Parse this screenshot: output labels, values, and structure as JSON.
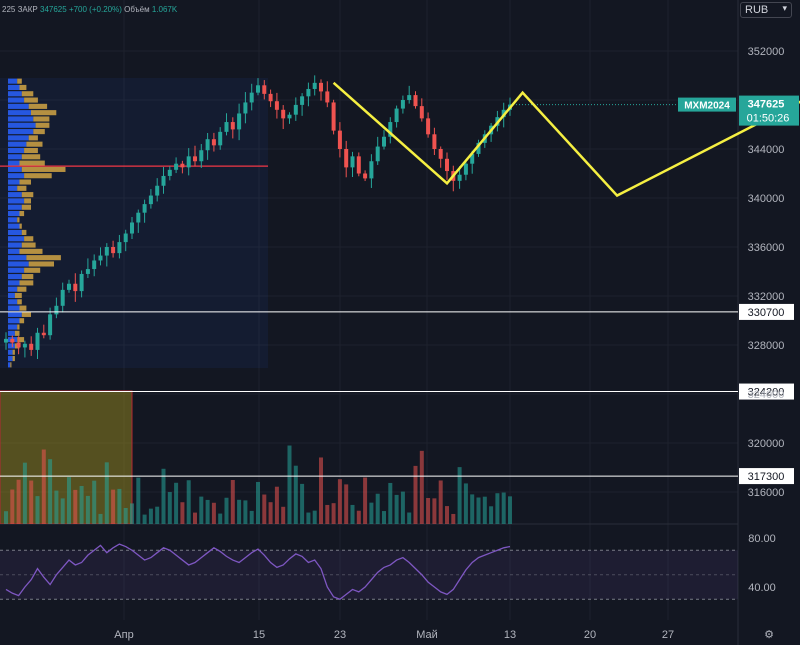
{
  "legend": {
    "prefix": "225",
    "close_label": "ЗАКР",
    "close_value": "347625",
    "change": "+700 (+0.20%)",
    "volume_label": "Объём",
    "volume_value": "1.067K"
  },
  "currency": "RUB",
  "symbol": "MXM2024",
  "last_price": "347625",
  "countdown": "01:50:26",
  "colors": {
    "background": "#131722",
    "up": "#26a69a",
    "down": "#ef5350",
    "annotation": "#f5ef42",
    "rsi": "#7e57c2",
    "poc": "#f23645",
    "level": "#ffffff",
    "vp_up": "#2962ff",
    "vp_down": "#d1a544"
  },
  "chart_data": {
    "type": "candlestick",
    "y_axis": {
      "range": [
        313000,
        355000
      ],
      "ticks": [
        316000,
        320000,
        324000,
        328000,
        332000,
        336000,
        340000,
        344000,
        348000,
        352000
      ]
    },
    "x_axis": {
      "ticks": [
        "Апр",
        "15",
        "23",
        "Май",
        "13",
        "20",
        "27"
      ]
    },
    "close_series": [
      328500,
      328200,
      327800,
      328100,
      327600,
      329000,
      328800,
      330500,
      331200,
      332500,
      333000,
      332400,
      333800,
      334200,
      334900,
      335300,
      336000,
      335500,
      336400,
      337100,
      338000,
      338800,
      339500,
      340200,
      341000,
      341800,
      342300,
      342800,
      342500,
      343400,
      343000,
      343900,
      344800,
      344300,
      345400,
      346200,
      345600,
      346900,
      347800,
      348600,
      349200,
      348500,
      347900,
      347200,
      346500,
      346800,
      347600,
      348300,
      348900,
      349400,
      348700,
      347800,
      345500,
      344000,
      342500,
      343400,
      342000,
      341600,
      343000,
      344200,
      345000,
      346200,
      347300,
      348000,
      348400,
      347500,
      346500,
      345200,
      344000,
      343200,
      342200,
      341400,
      341900,
      342800,
      343600,
      344500,
      345200,
      345900,
      346600,
      347200,
      347625
    ],
    "horizontal_levels": [
      330700,
      324200,
      317300
    ],
    "poc_level": 342600,
    "annotation_path": [
      {
        "bar": 52,
        "price": 349400
      },
      {
        "bar": 70,
        "price": 341200
      },
      {
        "bar": 82,
        "price": 348600
      },
      {
        "bar": 97,
        "price": 340200
      },
      {
        "bar": 157,
        "price": 356000
      }
    ],
    "rsi": {
      "levels": [
        "80.00",
        "40.00"
      ],
      "band": [
        70,
        30
      ],
      "values": [
        38,
        35,
        33,
        40,
        46,
        55,
        48,
        42,
        50,
        56,
        62,
        58,
        60,
        66,
        70,
        74,
        68,
        72,
        75,
        73,
        70,
        66,
        62,
        64,
        68,
        72,
        70,
        66,
        62,
        58,
        60,
        64,
        68,
        72,
        69,
        65,
        62,
        60,
        64,
        68,
        71,
        66,
        60,
        56,
        58,
        63,
        67,
        65,
        60,
        62,
        55,
        40,
        32,
        30,
        34,
        38,
        36,
        40,
        46,
        52,
        56,
        58,
        62,
        64,
        60,
        55,
        50,
        44,
        40,
        36,
        34,
        38,
        46,
        54,
        60,
        64,
        66,
        68,
        70,
        72,
        73
      ]
    },
    "volume_profile": {
      "price_rows": [
        349500,
        349000,
        348500,
        348000,
        347500,
        347000,
        346500,
        346000,
        345500,
        345000,
        344500,
        344000,
        343500,
        343000,
        342500,
        342000,
        341500,
        341000,
        340500,
        340000,
        339500,
        339000,
        338500,
        338000,
        337500,
        337000,
        336500,
        336000,
        335500,
        335000,
        334500,
        334000,
        333500,
        333000,
        332500,
        332000,
        331500,
        331000,
        330500,
        330000,
        329500,
        329000,
        328500,
        328000,
        327500,
        327000
      ],
      "up_volume": [
        8,
        10,
        12,
        14,
        18,
        20,
        22,
        24,
        22,
        18,
        16,
        14,
        12,
        10,
        12,
        14,
        10,
        8,
        12,
        14,
        12,
        10,
        8,
        10,
        12,
        14,
        12,
        10,
        16,
        18,
        14,
        12,
        10,
        8,
        6,
        8,
        10,
        12,
        10,
        8,
        6,
        8,
        6,
        4,
        4,
        2
      ],
      "down_volume": [
        4,
        6,
        10,
        12,
        16,
        22,
        14,
        12,
        10,
        8,
        14,
        12,
        16,
        22,
        38,
        24,
        10,
        8,
        10,
        6,
        8,
        4,
        2,
        2,
        4,
        8,
        12,
        20,
        30,
        22,
        14,
        10,
        12,
        8,
        6,
        4,
        6,
        8,
        4,
        2,
        4,
        6,
        4,
        2,
        2,
        1
      ]
    }
  }
}
